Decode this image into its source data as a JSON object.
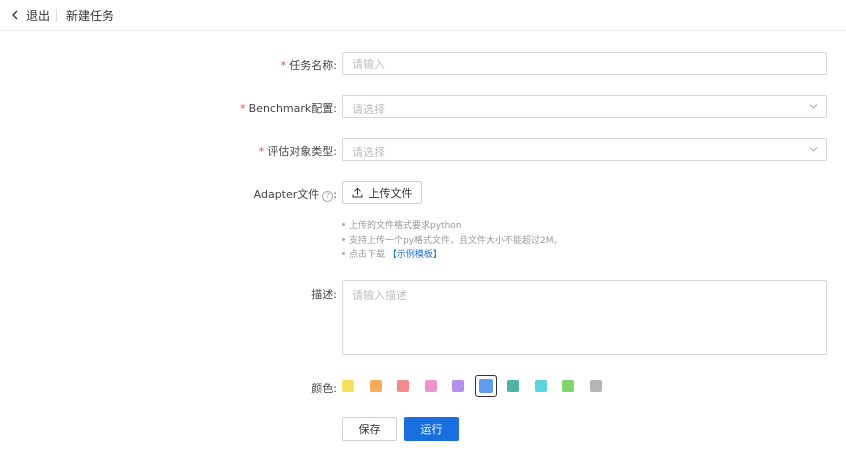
{
  "header": {
    "back_label": "退出",
    "title": "新建任务"
  },
  "form": {
    "task_name": {
      "required": "*",
      "label": "任务名称:",
      "placeholder": "请输入"
    },
    "benchmark": {
      "required": "*",
      "label": "Benchmark配置:",
      "placeholder": "请选择"
    },
    "eval_type": {
      "required": "*",
      "label": "评估对象类型:",
      "placeholder": "请选择"
    },
    "adapter": {
      "label": "Adapter文件",
      "help_icon": "?",
      "colon": ":",
      "upload_label": "上传文件",
      "hints": [
        "上传的文件格式要求python",
        "支持上传一个py格式文件，且文件大小不能超过2M。"
      ],
      "download_prefix": "点击下载",
      "download_link": "【示例模板】"
    },
    "description": {
      "label": "描述:",
      "placeholder": "请输入描述"
    },
    "color": {
      "label": "颜色:",
      "options": [
        "#f9e05c",
        "#f8ac57",
        "#f48a8a",
        "#f294c9",
        "#b48ef0",
        "#5f9cf2",
        "#4eb5a4",
        "#58d5de",
        "#7fd46a",
        "#b6b6b6"
      ],
      "selected_index": 5
    },
    "save_label": "保存",
    "run_label": "运行"
  },
  "colors": {
    "primary": "#1a6fe0",
    "required": "#f04848"
  }
}
